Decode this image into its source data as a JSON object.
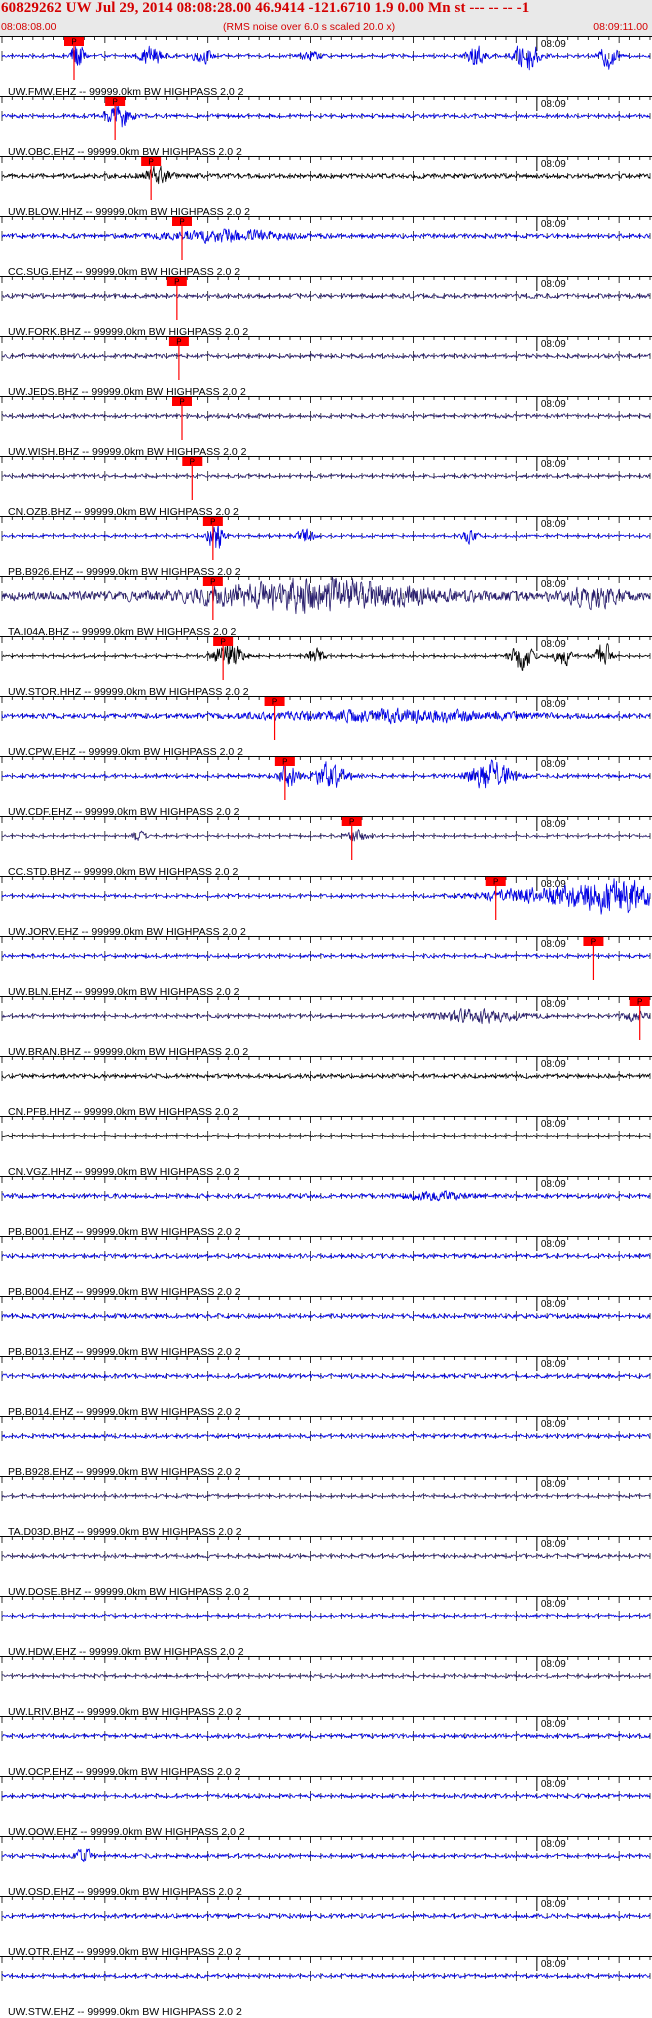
{
  "header": {
    "title": "60829262 UW Jul 29, 2014 08:08:28.00   46.9414 -121.6710  1.9 0.00 Mn st --- -- --  -1",
    "start_time": "08:08:08.00",
    "noise_note": "(RMS noise over 6.0 s scaled 20.0 x)",
    "end_time": "08:09:11.00"
  },
  "colors": {
    "blue": "#0000e6",
    "navy": "#2a1f6e",
    "black": "#000000",
    "pick": "#ff0000",
    "header_text": "#d40000",
    "header_bg": "#e9e9e9"
  },
  "chart_data": {
    "type": "line",
    "x_range_seconds": [
      0,
      63
    ],
    "minute_mark_seconds": 52,
    "minute_label": "08:09",
    "pick_label": "P",
    "filter_suffix": "HIGHPASS  2.0  2",
    "traces": [
      {
        "label": "UW.FMW.EHZ -- 99999.0km BW  HIGHPASS  2.0  2",
        "color": "blue",
        "amp": 0.1,
        "pick_s": 7.0,
        "bursts": [
          [
            7.3,
            1.0,
            0.7
          ],
          [
            14.5,
            0.7,
            1.0
          ],
          [
            19.5,
            0.45,
            0.9
          ],
          [
            30,
            0.3,
            1.0
          ],
          [
            46,
            0.7,
            1.0
          ],
          [
            51,
            1.0,
            1.2
          ],
          [
            59,
            0.9,
            0.8
          ]
        ]
      },
      {
        "label": "UW.OBC.EHZ -- 99999.0km BW  HIGHPASS  2.0  2",
        "color": "blue",
        "amp": 0.12,
        "pick_s": 11.0,
        "bursts": [
          [
            11.3,
            0.9,
            1.1
          ]
        ]
      },
      {
        "label": "UW.BLOW.HHZ -- 99999.0km BW  HIGHPASS  2.0  2",
        "color": "black",
        "amp": 0.15,
        "pick_s": 14.5,
        "bursts": [
          [
            15.0,
            0.6,
            1.3
          ]
        ]
      },
      {
        "label": "CC.SUG.EHZ -- 99999.0km BW  HIGHPASS  2.0  2",
        "color": "blue",
        "amp": 0.14,
        "pick_s": 17.5,
        "bursts": [
          [
            22.0,
            0.35,
            6.0
          ]
        ]
      },
      {
        "label": "UW.FORK.BHZ -- 99999.0km BW  HIGHPASS  2.0  2",
        "color": "navy",
        "amp": 0.14,
        "pick_s": 17.0,
        "bursts": []
      },
      {
        "label": "UW.JEDS.BHZ -- 99999.0km BW  HIGHPASS  2.0  2",
        "color": "navy",
        "amp": 0.13,
        "pick_s": 17.2,
        "bursts": []
      },
      {
        "label": "UW.WISH.BHZ -- 99999.0km BW  HIGHPASS  2.0  2",
        "color": "navy",
        "amp": 0.12,
        "pick_s": 17.5,
        "bursts": []
      },
      {
        "label": "CN.OZB.BHZ -- 99999.0km BW  HIGHPASS  2.0  2",
        "color": "navy",
        "amp": 0.11,
        "pick_s": 18.5,
        "bursts": []
      },
      {
        "label": "PB.B926.EHZ -- 99999.0km BW  HIGHPASS  2.0  2",
        "color": "blue",
        "amp": 0.09,
        "pick_s": 20.5,
        "bursts": [
          [
            20.8,
            1.0,
            0.8
          ],
          [
            29.5,
            0.5,
            0.9
          ],
          [
            45.5,
            0.4,
            0.7
          ]
        ]
      },
      {
        "label": "TA.I04A.BHZ -- 99999.0km BW  HIGHPASS  2.0  2",
        "color": "navy",
        "amp": 0.3,
        "pick_s": 20.5,
        "bursts": [
          [
            31.0,
            1.0,
            10.0
          ],
          [
            57.5,
            0.55,
            2.5
          ]
        ]
      },
      {
        "label": "UW.STOR.HHZ -- 99999.0km BW  HIGHPASS  2.0  2",
        "color": "black",
        "amp": 0.08,
        "pick_s": 21.5,
        "bursts": [
          [
            22.0,
            1.0,
            1.3
          ],
          [
            30.5,
            0.6,
            0.8
          ],
          [
            50.5,
            1.0,
            1.0
          ],
          [
            54.5,
            0.7,
            0.8
          ],
          [
            58.5,
            1.0,
            0.8
          ]
        ]
      },
      {
        "label": "UW.CPW.EHZ -- 99999.0km BW  HIGHPASS  2.0  2",
        "color": "blue",
        "amp": 0.16,
        "pick_s": 26.5,
        "bursts": [
          [
            38.0,
            0.35,
            12.0
          ]
        ]
      },
      {
        "label": "UW.CDF.EHZ -- 99999.0km BW  HIGHPASS  2.0  2",
        "color": "blue",
        "amp": 0.12,
        "pick_s": 27.5,
        "bursts": [
          [
            27.8,
            0.8,
            0.9
          ],
          [
            32.0,
            0.9,
            1.5
          ],
          [
            47.5,
            1.0,
            2.0
          ]
        ]
      },
      {
        "label": "CC.STD.BHZ -- 99999.0km BW  HIGHPASS  2.0  2",
        "color": "navy",
        "amp": 0.08,
        "pick_s": 34.0,
        "bursts": [
          [
            13.2,
            0.35,
            0.6
          ],
          [
            34.5,
            0.4,
            1.0
          ]
        ]
      },
      {
        "label": "UW.JORV.EHZ -- 99999.0km BW  HIGHPASS  2.0  2",
        "color": "blue",
        "amp": 0.1,
        "pick_s": 48.0,
        "bursts": [
          [
            53.0,
            0.6,
            6.0
          ],
          [
            60.0,
            1.0,
            4.0
          ]
        ]
      },
      {
        "label": "UW.BLN.EHZ -- 99999.0km BW  HIGHPASS  2.0  2",
        "color": "blue",
        "amp": 0.11,
        "pick_s": 57.5,
        "bursts": []
      },
      {
        "label": "UW.BRAN.BHZ -- 99999.0km BW  HIGHPASS  2.0  2",
        "color": "navy",
        "amp": 0.11,
        "pick_s": 62.0,
        "bursts": [
          [
            46.5,
            0.45,
            4.0
          ],
          [
            61.5,
            0.25,
            1.5
          ]
        ]
      },
      {
        "label": "CN.PFB.HHZ -- 99999.0km BW  HIGHPASS  2.0  2",
        "color": "black",
        "amp": 0.13,
        "pick_s": null,
        "bursts": []
      },
      {
        "label": "CN.VGZ.HHZ -- 99999.0km BW  HIGHPASS  2.0  2",
        "color": "black",
        "amp": 0.05,
        "pick_s": null,
        "bursts": []
      },
      {
        "label": "PB.B001.EHZ -- 99999.0km BW  HIGHPASS  2.0  2",
        "color": "blue",
        "amp": 0.14,
        "pick_s": null,
        "bursts": [
          [
            42.0,
            0.25,
            3.0
          ]
        ]
      },
      {
        "label": "PB.B004.EHZ -- 99999.0km BW  HIGHPASS  2.0  2",
        "color": "blue",
        "amp": 0.13,
        "pick_s": null,
        "bursts": []
      },
      {
        "label": "PB.B013.EHZ -- 99999.0km BW  HIGHPASS  2.0  2",
        "color": "blue",
        "amp": 0.14,
        "pick_s": null,
        "bursts": []
      },
      {
        "label": "PB.B014.EHZ -- 99999.0km BW  HIGHPASS  2.0  2",
        "color": "blue",
        "amp": 0.13,
        "pick_s": null,
        "bursts": []
      },
      {
        "label": "PB.B928.EHZ -- 99999.0km BW  HIGHPASS  2.0  2",
        "color": "blue",
        "amp": 0.12,
        "pick_s": null,
        "bursts": []
      },
      {
        "label": "TA.D03D.BHZ -- 99999.0km BW  HIGHPASS  2.0  2",
        "color": "navy",
        "amp": 0.1,
        "pick_s": null,
        "bursts": []
      },
      {
        "label": "UW.DOSE.BHZ -- 99999.0km BW  HIGHPASS  2.0  2",
        "color": "navy",
        "amp": 0.11,
        "pick_s": null,
        "bursts": []
      },
      {
        "label": "UW.HDW.EHZ -- 99999.0km BW  HIGHPASS  2.0  2",
        "color": "blue",
        "amp": 0.09,
        "pick_s": null,
        "bursts": []
      },
      {
        "label": "UW.LRIV.BHZ -- 99999.0km BW  HIGHPASS  2.0  2",
        "color": "navy",
        "amp": 0.1,
        "pick_s": null,
        "bursts": []
      },
      {
        "label": "UW.OCP.EHZ -- 99999.0km BW  HIGHPASS  2.0  2",
        "color": "blue",
        "amp": 0.13,
        "pick_s": null,
        "bursts": []
      },
      {
        "label": "UW.OOW.EHZ -- 99999.0km BW  HIGHPASS  2.0  2",
        "color": "blue",
        "amp": 0.12,
        "pick_s": null,
        "bursts": []
      },
      {
        "label": "UW.OSD.EHZ -- 99999.0km BW  HIGHPASS  2.0  2",
        "color": "blue",
        "amp": 0.12,
        "pick_s": null,
        "bursts": [
          [
            8.0,
            0.5,
            0.8
          ]
        ]
      },
      {
        "label": "UW.OTR.EHZ -- 99999.0km BW  HIGHPASS  2.0  2",
        "color": "blue",
        "amp": 0.13,
        "pick_s": null,
        "bursts": []
      },
      {
        "label": "UW.STW.EHZ -- 99999.0km BW  HIGHPASS  2.0  2",
        "color": "blue",
        "amp": 0.12,
        "pick_s": null,
        "bursts": []
      }
    ]
  }
}
